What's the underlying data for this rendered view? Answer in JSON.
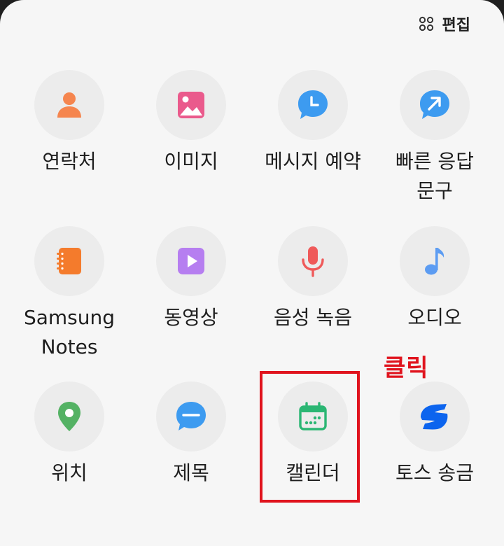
{
  "header": {
    "edit_label": "편집",
    "edit_icon": "grid-dots-icon"
  },
  "items": [
    {
      "label": "연락처",
      "icon": "contact-person-icon",
      "color": "#f5854e"
    },
    {
      "label": "이미지",
      "icon": "image-icon",
      "color": "#ea5a8c"
    },
    {
      "label": "메시지 예약",
      "icon": "scheduled-message-clock-icon",
      "color": "#3d9bf0"
    },
    {
      "label": "빠른 응답\n문구",
      "icon": "quick-reply-arrow-icon",
      "color": "#3d9bf0"
    },
    {
      "label": "Samsung\nNotes",
      "icon": "samsung-notes-icon",
      "color": "#f47b2c"
    },
    {
      "label": "동영상",
      "icon": "video-play-icon",
      "color": "#b67ef0"
    },
    {
      "label": "음성 녹음",
      "icon": "microphone-icon",
      "color": "#ef5a5a"
    },
    {
      "label": "오디오",
      "icon": "music-note-icon",
      "color": "#5c9cf2"
    },
    {
      "label": "위치",
      "icon": "location-pin-icon",
      "color": "#54b264"
    },
    {
      "label": "제목",
      "icon": "subject-bubble-icon",
      "color": "#3d9bf0"
    },
    {
      "label": "캘린더",
      "icon": "calendar-icon",
      "color": "#2bb673"
    },
    {
      "label": "토스 송금",
      "icon": "toss-icon",
      "color": "#0c64ee"
    }
  ],
  "annotation": {
    "text": "클릭",
    "color": "#e0141e"
  }
}
